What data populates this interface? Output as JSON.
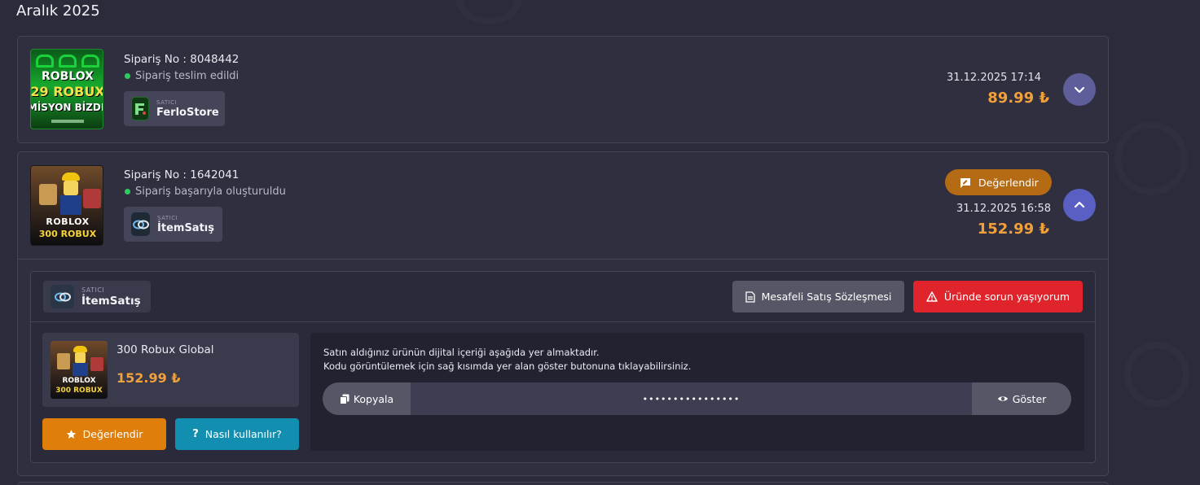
{
  "month_title": "Aralık 2025",
  "orders": [
    {
      "order_no": "Sipariş No : 8048442",
      "status": "Sipariş teslim edildi",
      "seller_caption": "SATICI",
      "seller_name": "FerloStore",
      "date": "31.12.2025 17:14",
      "price": "89.99 ₺",
      "thumb_lines": [
        "ROBLOX",
        "29 ROBUX",
        "MİSYON BİZDE"
      ],
      "toggle_icon": "chevron-down-icon"
    },
    {
      "order_no": "Sipariş No : 1642041",
      "status": "Sipariş başarıyla oluşturuldu",
      "seller_caption": "SATICI",
      "seller_name": "İtemSatış",
      "rate_label": "Değerlendir",
      "date": "31.12.2025 16:58",
      "price": "152.99 ₺",
      "thumb_lines": [
        "ROBLOX",
        "300 ROBUX"
      ],
      "toggle_icon": "chevron-up-icon",
      "details": {
        "seller_caption": "SATICI",
        "seller_name": "İtemSatış",
        "contract_label": "Mesafeli Satış Sözleşmesi",
        "problem_label": "Üründe sorun yaşıyorum",
        "product_name": "300 Robux Global",
        "product_price": "152.99 ₺",
        "rate_label": "Değerlendir",
        "howto_label": "Nasıl kullanılır?",
        "content_line1": "Satın aldığınız ürünün dijital içeriği aşağıda yer almaktadır.",
        "content_line2": "Kodu görüntülemek için sağ kısımda yer alan göster butonuna tıklayabilirsiniz.",
        "copy_label": "Kopyala",
        "masked_code": "••••••••••••••••",
        "show_label": "Göster"
      }
    }
  ],
  "colors": {
    "background": "#2b2b3b",
    "card": "#2f2f40",
    "price": "#f0a03c",
    "status_dot": "#2ecc5f",
    "toggle_collapsed": "#5e5e9a",
    "toggle_expanded": "#5a5fc4",
    "rate_pill": "#b56a14",
    "problem": "#e0242c",
    "rate_button": "#e07e0b",
    "howto_button": "#128fb0"
  }
}
